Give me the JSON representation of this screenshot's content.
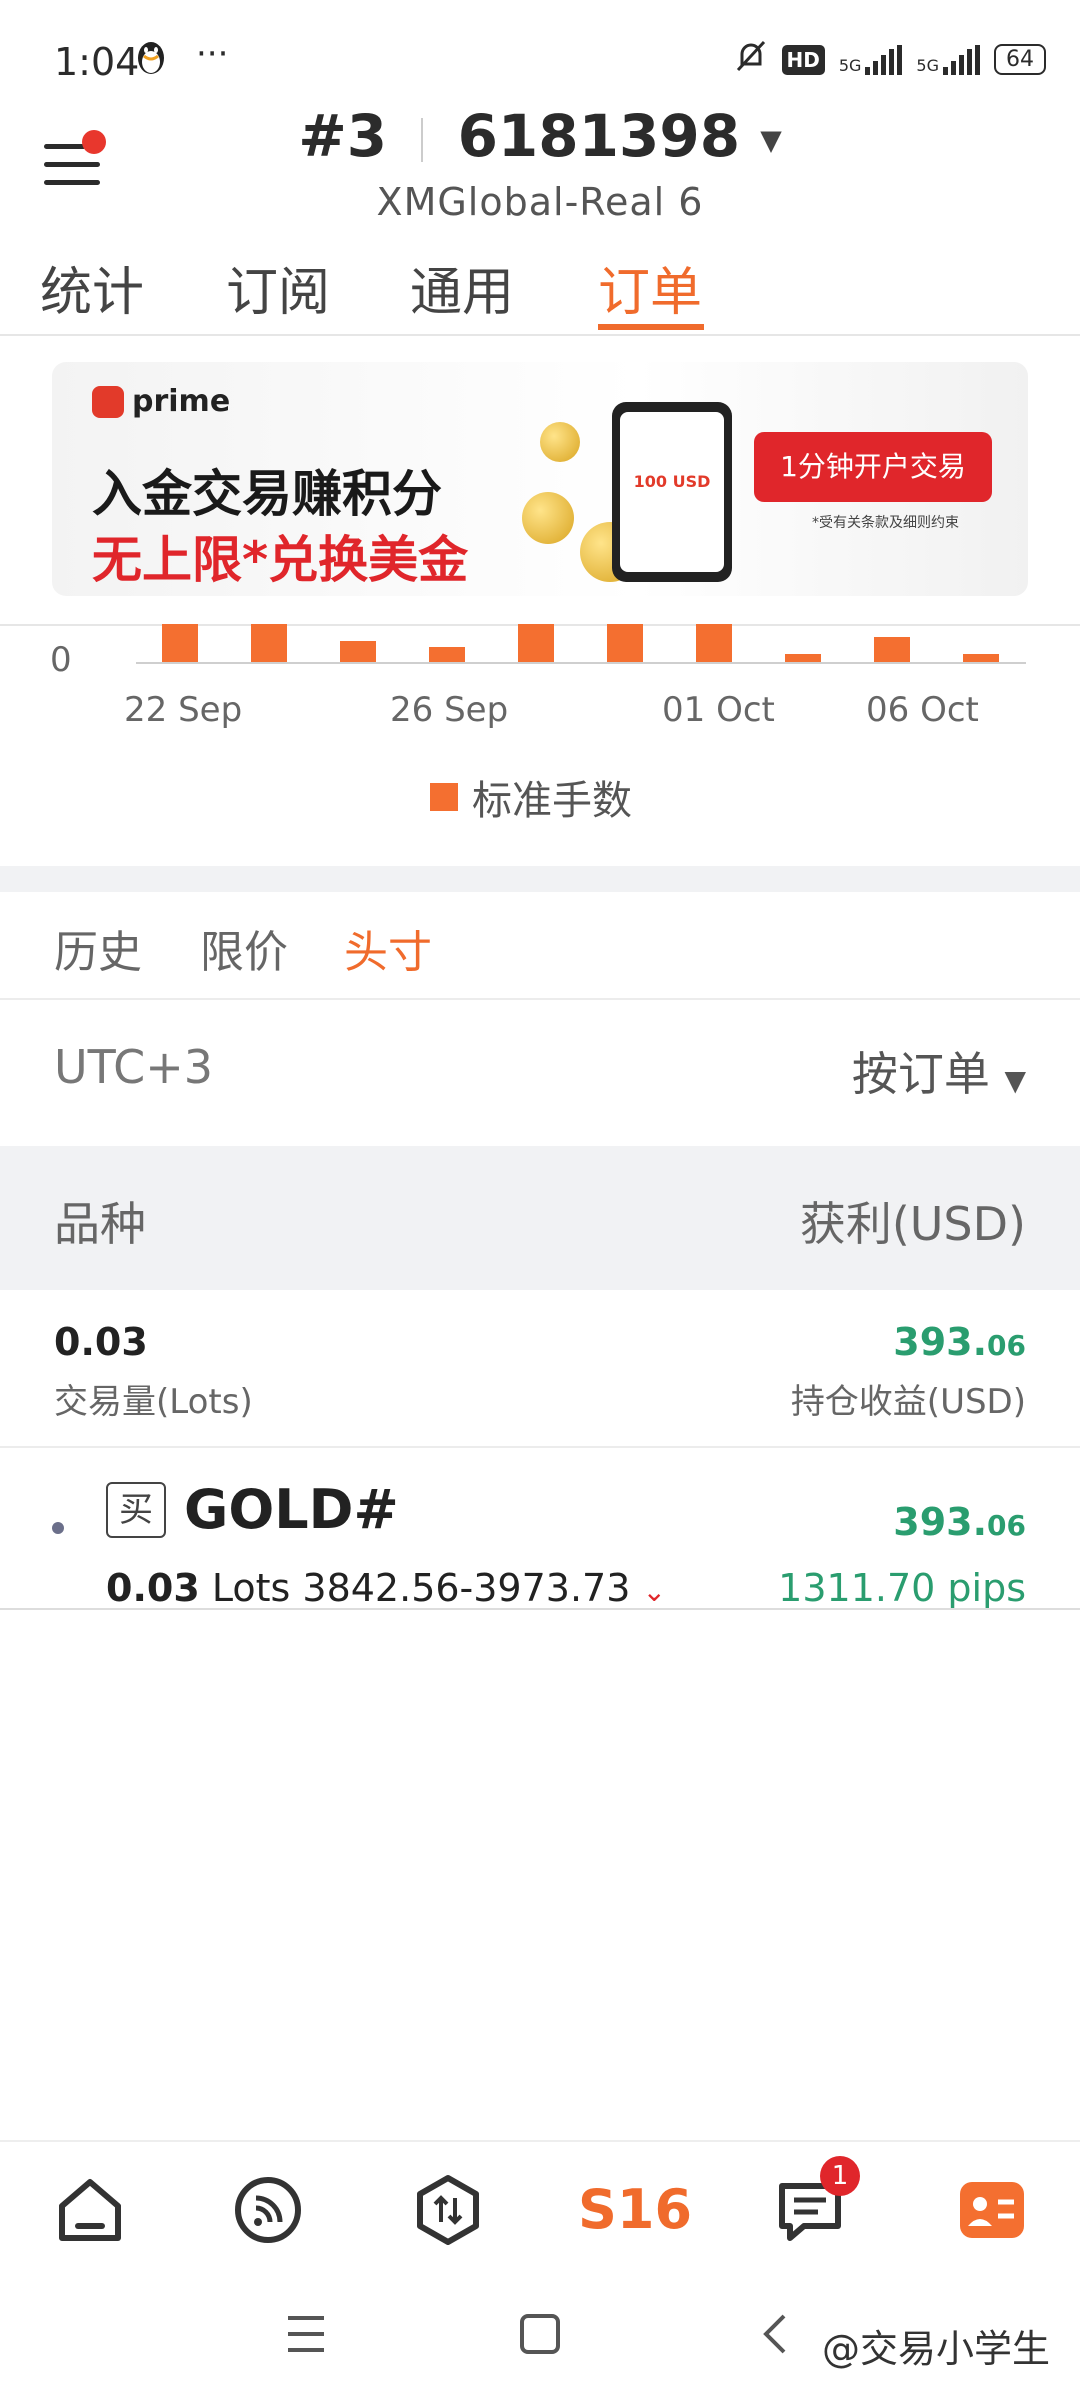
{
  "status_bar": {
    "time": "1:04",
    "more": "···",
    "hd": "HD",
    "net1": "5G",
    "net2": "5G",
    "battery": "64"
  },
  "header": {
    "account_prefix": "#3",
    "account_number": "6181398",
    "server": "XMGlobal-Real 6"
  },
  "tabs": [
    {
      "label": "统计"
    },
    {
      "label": "订阅"
    },
    {
      "label": "通用"
    },
    {
      "label": "订单",
      "active": true
    }
  ],
  "banner": {
    "brand": "prime",
    "line1": "入金交易赚积分",
    "line2": "无上限*兑换美金",
    "phone_text": "100 USD",
    "cta": "1分钟开户交易",
    "note": "*受有关条款及细则约束"
  },
  "chart_data": {
    "type": "bar",
    "categories": [
      "",
      "",
      "",
      "",
      "",
      "",
      "",
      "",
      "",
      ""
    ],
    "values": [
      1.0,
      1.0,
      0.55,
      0.4,
      1.0,
      1.0,
      1.0,
      0.2,
      0.65,
      0.2
    ],
    "x_tick_labels": [
      "22 Sep",
      "26 Sep",
      "01 Oct",
      "06 Oct"
    ],
    "y_tick_labels": [
      "0"
    ],
    "legend": "标准手数",
    "color": "#f46f30"
  },
  "sub_tabs": [
    {
      "label": "历史"
    },
    {
      "label": "限价"
    },
    {
      "label": "头寸",
      "active": true
    }
  ],
  "filter": {
    "timezone": "UTC+3",
    "sort": "按订单"
  },
  "columns": {
    "left": "品种",
    "right": "获利(USD)"
  },
  "summary": {
    "lots": "0.03",
    "lots_label": "交易量(Lots)",
    "profit_main": "393.",
    "profit_dec": "06",
    "profit_label": "持仓收益(USD)"
  },
  "position": {
    "side": "买",
    "symbol": "GOLD#",
    "lots": "0.03",
    "lots_unit": "Lots",
    "price_range": "3842.56-3973.73",
    "profit_main": "393.",
    "profit_dec": "06",
    "pips": "1311.70 pips"
  },
  "bottom_nav": {
    "center_label": "S16",
    "messages_badge": "1"
  },
  "watermark": "@交易小学生"
}
